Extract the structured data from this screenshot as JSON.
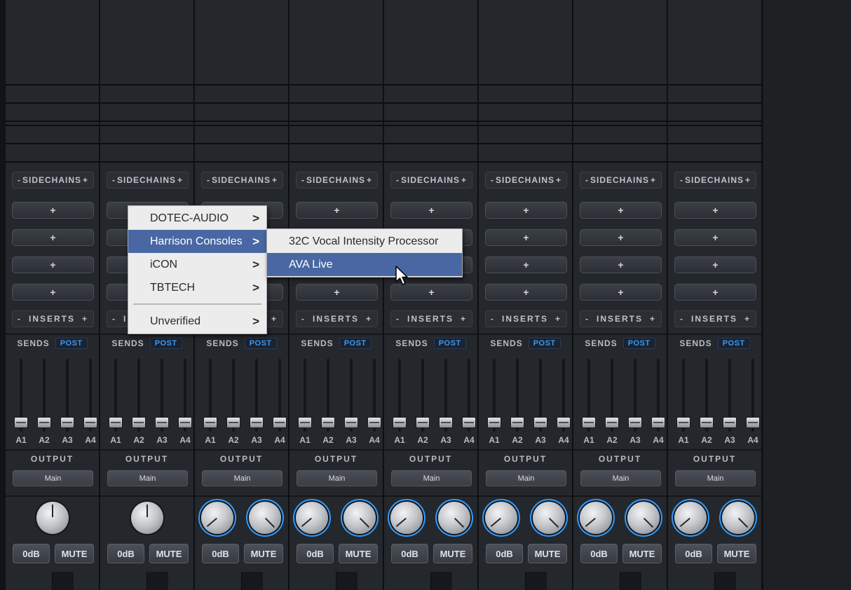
{
  "strips": [
    {
      "sidechains": "SIDECHAINS",
      "inserts": "INSERTS",
      "sends": "SENDS",
      "post": "POST",
      "output_label": "OUTPUT",
      "output": "Main",
      "gain": "0dB",
      "mute": "MUTE",
      "knobs": 1
    },
    {
      "sidechains": "SIDECHAINS",
      "inserts": "INSERTS",
      "sends": "SENDS",
      "post": "POST",
      "output_label": "OUTPUT",
      "output": "Main",
      "gain": "0dB",
      "mute": "MUTE",
      "knobs": 1
    },
    {
      "sidechains": "SIDECHAINS",
      "inserts": "INSERTS",
      "sends": "SENDS",
      "post": "POST",
      "output_label": "OUTPUT",
      "output": "Main",
      "gain": "0dB",
      "mute": "MUTE",
      "knobs": 2
    },
    {
      "sidechains": "SIDECHAINS",
      "inserts": "INSERTS",
      "sends": "SENDS",
      "post": "POST",
      "output_label": "OUTPUT",
      "output": "Main",
      "gain": "0dB",
      "mute": "MUTE",
      "knobs": 2
    },
    {
      "sidechains": "SIDECHAINS",
      "inserts": "INSERTS",
      "sends": "SENDS",
      "post": "POST",
      "output_label": "OUTPUT",
      "output": "Main",
      "gain": "0dB",
      "mute": "MUTE",
      "knobs": 2
    },
    {
      "sidechains": "SIDECHAINS",
      "inserts": "INSERTS",
      "sends": "SENDS",
      "post": "POST",
      "output_label": "OUTPUT",
      "output": "Main",
      "gain": "0dB",
      "mute": "MUTE",
      "knobs": 2
    },
    {
      "sidechains": "SIDECHAINS",
      "inserts": "INSERTS",
      "sends": "SENDS",
      "post": "POST",
      "output_label": "OUTPUT",
      "output": "Main",
      "gain": "0dB",
      "mute": "MUTE",
      "knobs": 2
    },
    {
      "sidechains": "SIDECHAINS",
      "inserts": "INSERTS",
      "sends": "SENDS",
      "post": "POST",
      "output_label": "OUTPUT",
      "output": "Main",
      "gain": "0dB",
      "mute": "MUTE",
      "knobs": 2
    }
  ],
  "send_labels": [
    "A1",
    "A2",
    "A3",
    "A4"
  ],
  "symbols": {
    "minus": "-",
    "plus": "+"
  },
  "context_menu": {
    "items": [
      "DOTEC-AUDIO",
      "Harrison Consoles",
      "iCON",
      "TBTECH",
      "Unverified"
    ],
    "chevron": ">",
    "highlighted": "Harrison Consoles"
  },
  "submenu": {
    "items": [
      "32C Vocal Intensity Processor",
      "AVA Live"
    ],
    "highlighted": "AVA Live"
  },
  "colors": {
    "accent": "#2f9bff",
    "menu_highlight": "#4867a3",
    "post_text": "#3a9bf0"
  },
  "icons": {
    "chevron": "chevron-right-icon",
    "cursor": "mouse-pointer-icon"
  }
}
